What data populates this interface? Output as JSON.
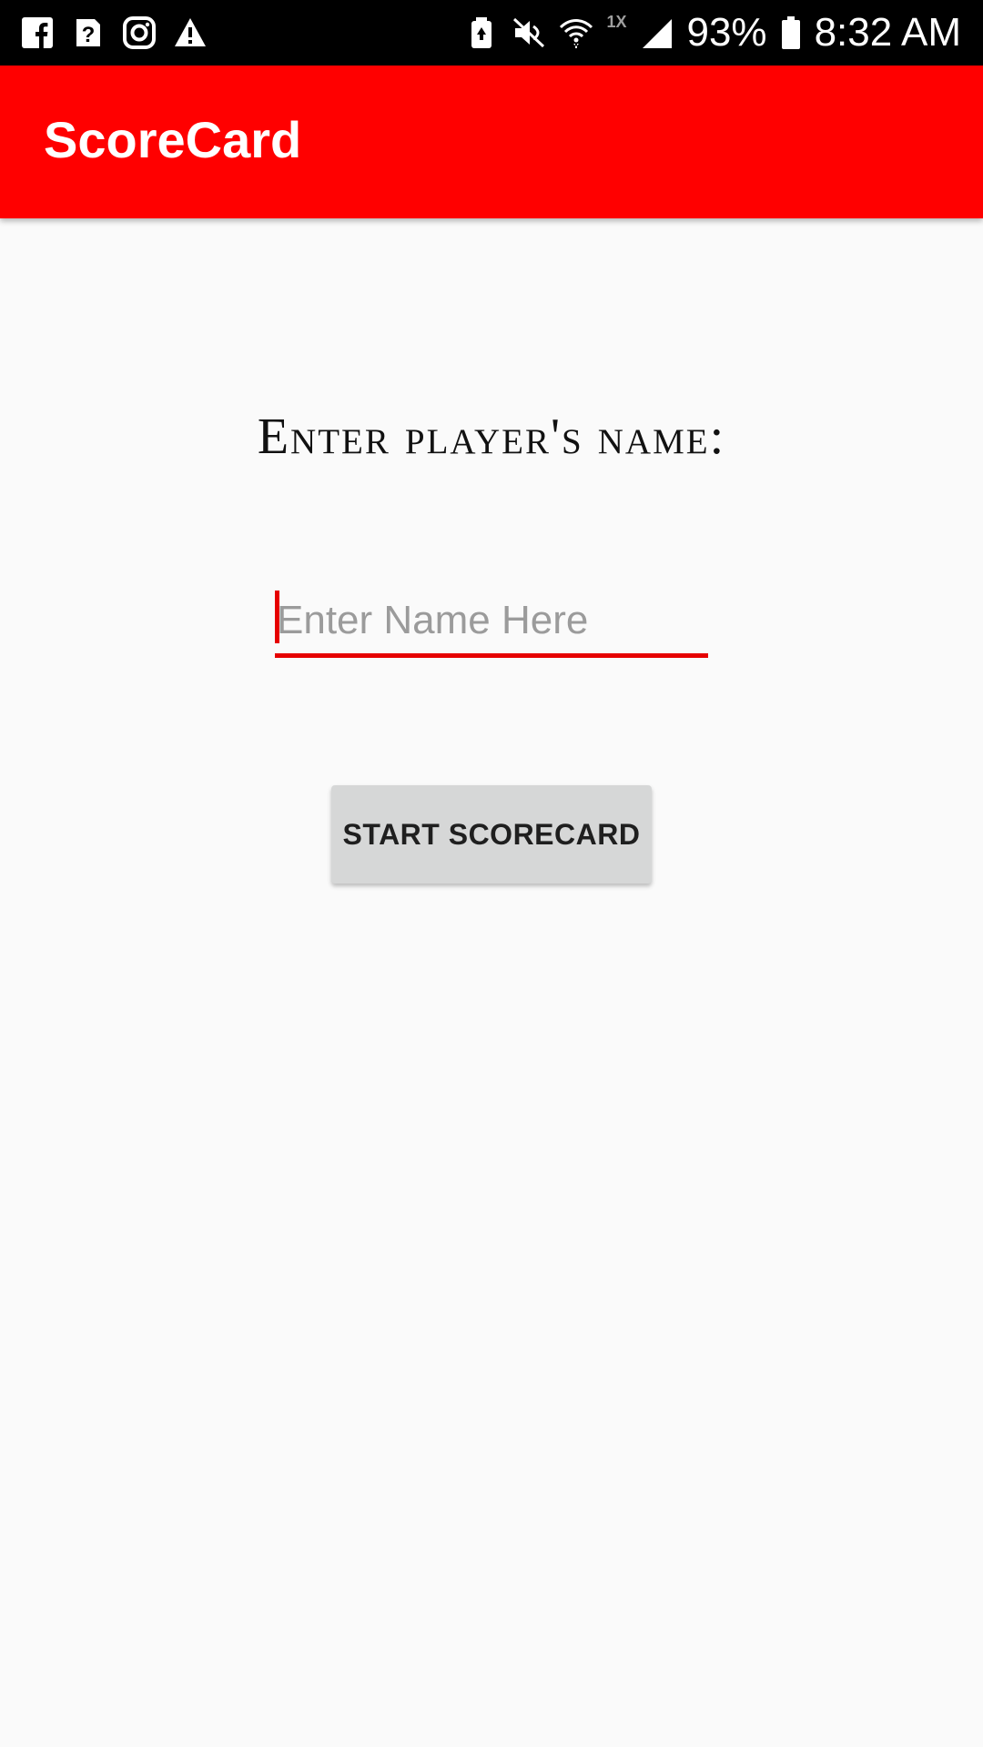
{
  "status_bar": {
    "notification_icons": [
      "facebook-icon",
      "help-card-icon",
      "instagram-icon",
      "warning-icon"
    ],
    "system_icons": [
      "battery-saver-icon",
      "mute-icon",
      "wifi-icon",
      "signal-icon",
      "battery-icon"
    ],
    "speed_label": "1X",
    "battery_percent": "93%",
    "time": "8:32 AM"
  },
  "app_bar": {
    "title": "ScoreCard",
    "color": "#ff0000"
  },
  "main": {
    "prompt": "Enter player's name:",
    "name_input": {
      "placeholder": "Enter Name Here",
      "value": ""
    },
    "start_button_label": "START SCORECARD"
  },
  "colors": {
    "accent": "#e60000",
    "background": "#fafafa",
    "button": "#d6d7d7"
  }
}
